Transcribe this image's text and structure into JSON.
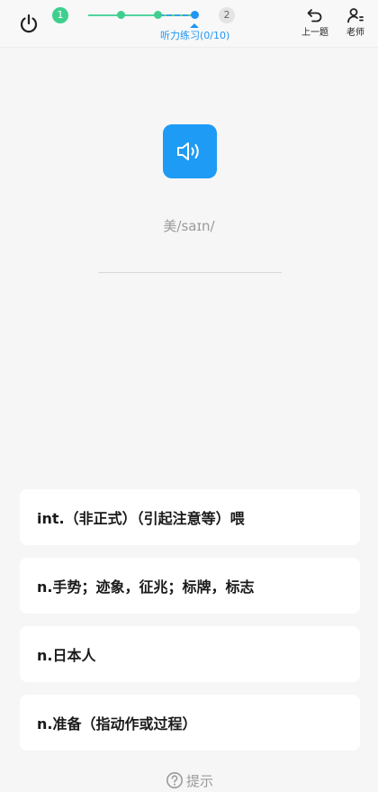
{
  "header": {
    "step_current": "1",
    "step_next": "2",
    "progress_label": "听力练习(0/10)",
    "prev_label": "上一题",
    "teacher_label": "老师",
    "progress_fraction": 0.0
  },
  "word": {
    "phonetic": "美/saɪn/"
  },
  "options": [
    {
      "text": "int.（非正式）（引起注意等）喂"
    },
    {
      "text": "n.手势；迹象，征兆；标牌，标志"
    },
    {
      "text": "n.日本人"
    },
    {
      "text": "n.准备（指动作或过程）"
    }
  ],
  "hint": {
    "label": "提示"
  },
  "colors": {
    "accent_blue": "#1e9bf5",
    "accent_green": "#3ecf8e",
    "background": "#f6f6f6"
  },
  "icons": {
    "power": "power-icon",
    "undo": "undo-icon",
    "teacher": "teacher-icon",
    "speaker": "speaker-icon",
    "hint": "question-circle-icon"
  }
}
